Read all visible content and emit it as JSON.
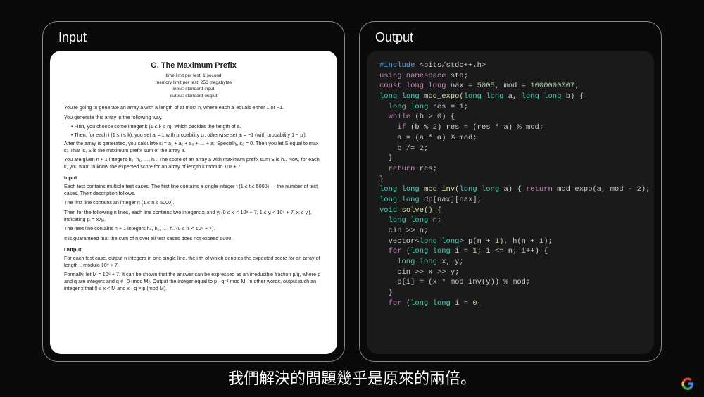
{
  "panels": {
    "input": {
      "label": "Input"
    },
    "output": {
      "label": "Output"
    }
  },
  "problem": {
    "title": "G. The Maximum Prefix",
    "meta1": "time limit per test: 1 second",
    "meta2": "memory limit per test: 256 megabytes",
    "meta3": "input: standard input",
    "meta4": "output: standard output",
    "p1": "You're going to generate an array a with a length of at most n, where each aᵢ equals either 1 or −1.",
    "p2": "You generate this array in the following way.",
    "li1": "First, you choose some integer k (1 ≤ k ≤ n), which decides the length of a.",
    "li2": "Then, for each i (1 ≤ i ≤ k), you set aᵢ = 1 with probability pᵢ, otherwise set aᵢ = −1 (with probability 1 − pᵢ).",
    "p3": "After the array is generated, you calculate sᵢ = a₁ + a₂ + a₃ + … + aᵢ. Specially, s₀ = 0. Then you let S equal to max sᵢ. That is, S is the maximum prefix sum of the array a.",
    "p4": "You are given n + 1 integers h₀, h₁, …, hₙ. The score of an array a with maximum prefix sum S is hₛ. Now, for each k, you want to know the expected score for an array of length k modulo 10⁹ + 7.",
    "h_input": "Input",
    "p5": "Each test contains multiple test cases. The first line contains a single integer t (1 ≤ t ≤ 5000) — the number of test cases. Their description follows.",
    "p6": "The first line contains an integer n (1 ≤ n ≤ 5000).",
    "p7": "Then for the following n lines, each line contains two integers xᵢ and yᵢ (0 ≤ xᵢ < 10⁹ + 7, 1 ≤ yᵢ < 10⁹ + 7, xᵢ ≤ yᵢ), indicating pᵢ = xᵢ/yᵢ.",
    "p8": "The next line contains n + 1 integers h₀, h₁, …, hₙ (0 ≤ hᵢ < 10⁹ + 7).",
    "p9": "It is guaranteed that the sum of n over all test cases does not exceed 5000.",
    "h_output": "Output",
    "p10": "For each test case, output n integers in one single line, the i-th of which denotes the expected score for an array of length i, modulo 10⁹ + 7.",
    "p11": "Formally, let M = 10⁹ + 7. It can be shown that the answer can be expressed as an irreducible fraction p/q, where p and q are integers and q ≢ 0 (mod M). Output the integer equal to p · q⁻¹ mod M. In other words, output such an integer x that 0 ≤ x < M and x · q ≡ p (mod M)."
  },
  "code": {
    "l01a": "#include",
    "l01b": " <bits/stdc++.h>",
    "l02a": "using namespace",
    "l02b": " std;",
    "l03a": "const long long",
    "l03b": " nax = ",
    "l03c": "5005",
    "l03d": ", mod = ",
    "l03e": "1000000007",
    "l03f": ";",
    "l04a": "long long",
    "l04b": " mod_expo(",
    "l04c": "long long",
    "l04d": " a, ",
    "l04e": "long long",
    "l04f": " b) {",
    "l05a": "  long long",
    "l05b": " res = ",
    "l05c": "1",
    "l05d": ";",
    "l06a": "  while",
    "l06b": " (b > ",
    "l06c": "0",
    "l06d": ") {",
    "l07a": "    if",
    "l07b": " (b % ",
    "l07c": "2",
    "l07d": ") res = (res * a) % mod;",
    "l08": "    a = (a * a) % mod;",
    "l09a": "    b /= ",
    "l09b": "2",
    "l09c": ";",
    "l10": "  }",
    "l11a": "  return",
    "l11b": " res;",
    "l12": "}",
    "l13a": "long long",
    "l13b": " mod_inv(",
    "l13c": "long long",
    "l13d": " a) { ",
    "l13e": "return",
    "l13f": " mod_expo(a, mod - ",
    "l13g": "2",
    "l13h": "); }",
    "l14a": "long long",
    "l14b": " dp[nax][nax];",
    "l15a": "void",
    "l15b": " solve() {",
    "l16a": "  long long",
    "l16b": " n;",
    "l17": "  cin >> n;",
    "l18a": "  vector<",
    "l18b": "long long",
    "l18c": "> p(n + ",
    "l18d": "1",
    "l18e": "), h(n + ",
    "l18f": "1",
    "l18g": ");",
    "l19a": "  for",
    "l19b": " (",
    "l19c": "long long",
    "l19d": " i = ",
    "l19e": "1",
    "l19f": "; i <= n; i++) {",
    "l20a": "    long long",
    "l20b": " x, y;",
    "l21": "    cin >> x >> y;",
    "l22": "    p[i] = (x * mod_inv(y)) % mod;",
    "l23": "  }",
    "l24a": "  for",
    "l24b": " (",
    "l24c": "long long",
    "l24d": " i = ",
    "l24e": "0",
    "l24f": "_"
  },
  "subtitle": "我們解決的問題幾乎是原來的兩倍。"
}
